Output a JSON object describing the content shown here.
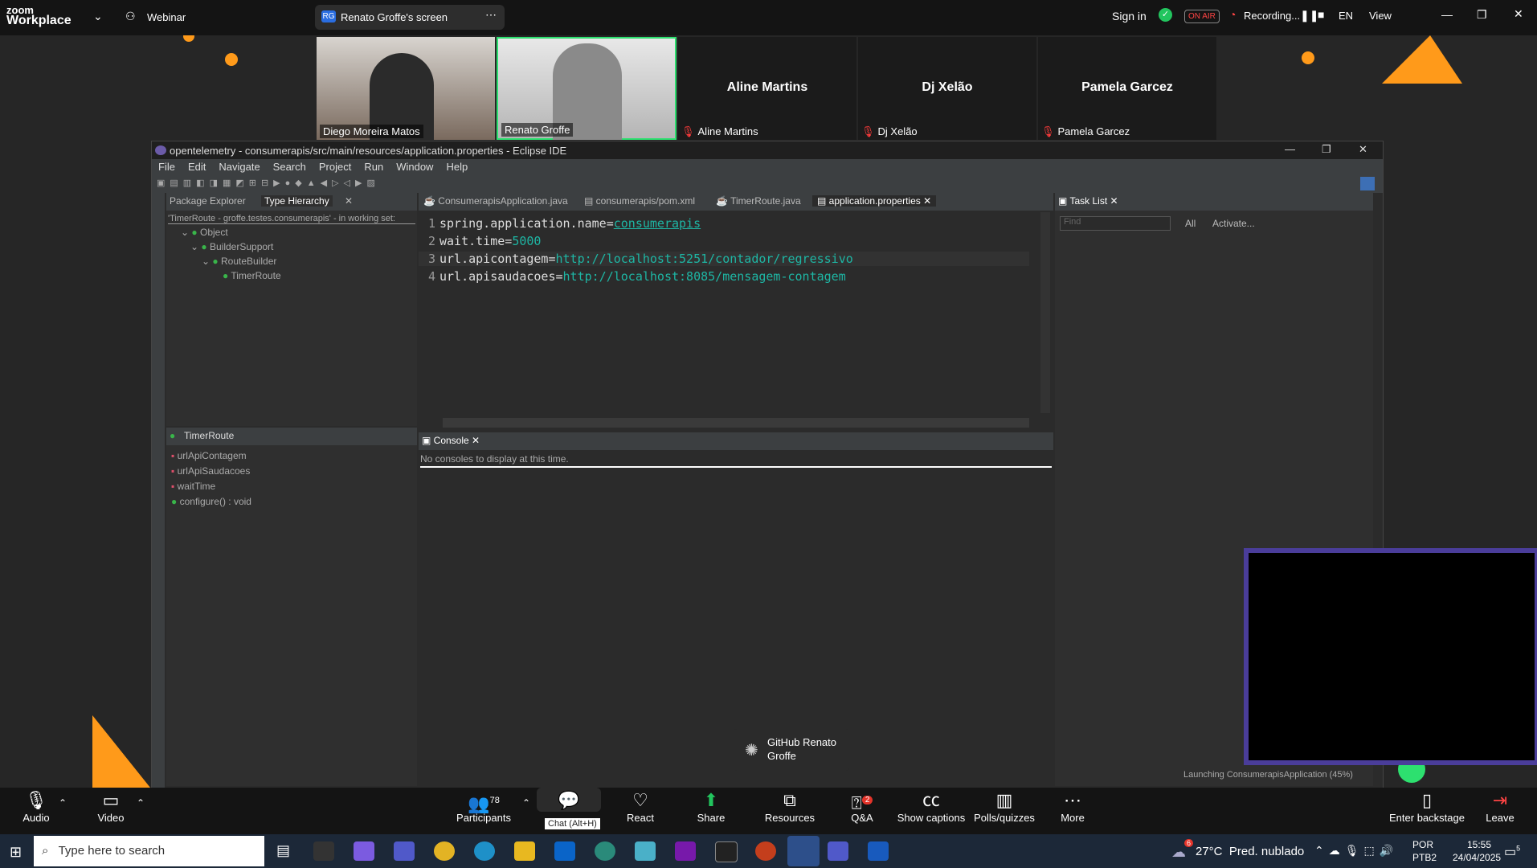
{
  "zoom": {
    "logo_line1": "zoom",
    "logo_line2": "Workplace",
    "webinar": "Webinar",
    "share_initials": "RG",
    "share_title": "Renato Groffe's screen",
    "sign_in": "Sign in",
    "on_air": "ON AIR",
    "recording": "Recording...",
    "lang": "EN",
    "view": "View"
  },
  "participants": [
    {
      "name": "Diego Moreira Matos",
      "video": true
    },
    {
      "name": "Renato Groffe",
      "video": true
    },
    {
      "name": "Aline Martins",
      "video": false
    },
    {
      "name": "Dj Xelão",
      "video": false
    },
    {
      "name": "Pamela Garcez",
      "video": false
    }
  ],
  "eclipse": {
    "title": "opentelemetry - consumerapis/src/main/resources/application.properties - Eclipse IDE",
    "menu": [
      "File",
      "Edit",
      "Navigate",
      "Search",
      "Project",
      "Run",
      "Window",
      "Help"
    ],
    "left_tabs": [
      "Package Explorer",
      "Type Hierarchy"
    ],
    "hierarchy_header": "'TimerRoute - groffe.testes.consumerapis' - in working set:",
    "hierarchy": [
      "Object",
      "BuilderSupport",
      "RouteBuilder",
      "TimerRoute"
    ],
    "members_title": "TimerRoute",
    "members": [
      "urlApiContagem",
      "urlApiSaudacoes",
      "waitTime",
      "configure() : void"
    ],
    "editor_tabs": [
      "ConsumerapisApplication.java",
      "consumerapis/pom.xml",
      "TimerRoute.java",
      "application.properties"
    ],
    "code": [
      {
        "num": "1",
        "key": "spring.application.name=",
        "value": "consumerapis"
      },
      {
        "num": "2",
        "key": "wait.time=",
        "value": "5000"
      },
      {
        "num": "3",
        "key": "url.apicontagem=",
        "value": "http://localhost:5251/contador/regressivo"
      },
      {
        "num": "4",
        "key": "url.apisaudacoes=",
        "value": "http://localhost:8085/mensagem-contagem"
      }
    ],
    "console_tab": "Console",
    "console_msg": "No consoles to display at this time.",
    "task_tab": "Task List",
    "task_find": "Find",
    "task_all": "All",
    "task_activate": "Activate...",
    "status": "Launching ConsumerapisApplication (45%)"
  },
  "toolbar": {
    "audio": "Audio",
    "video": "Video",
    "participants": "Participants",
    "participants_count": "78",
    "chat_tooltip": "Chat (Alt+H)",
    "react": "React",
    "share": "Share",
    "resources": "Resources",
    "qa": "Q&A",
    "qa_badge": "2",
    "captions": "Show captions",
    "polls": "Polls/quizzes",
    "more": "More",
    "backstage": "Enter backstage",
    "leave": "Leave"
  },
  "floating": {
    "label": "GitHub Renato Groffe"
  },
  "taskbar": {
    "search": "Type here to search",
    "weather": "27°C  Pred. nublado",
    "weather_badge": "6",
    "lang1": "POR",
    "lang2": "PTB2",
    "time": "15:55",
    "date": "24/04/2025",
    "notif": "5"
  }
}
